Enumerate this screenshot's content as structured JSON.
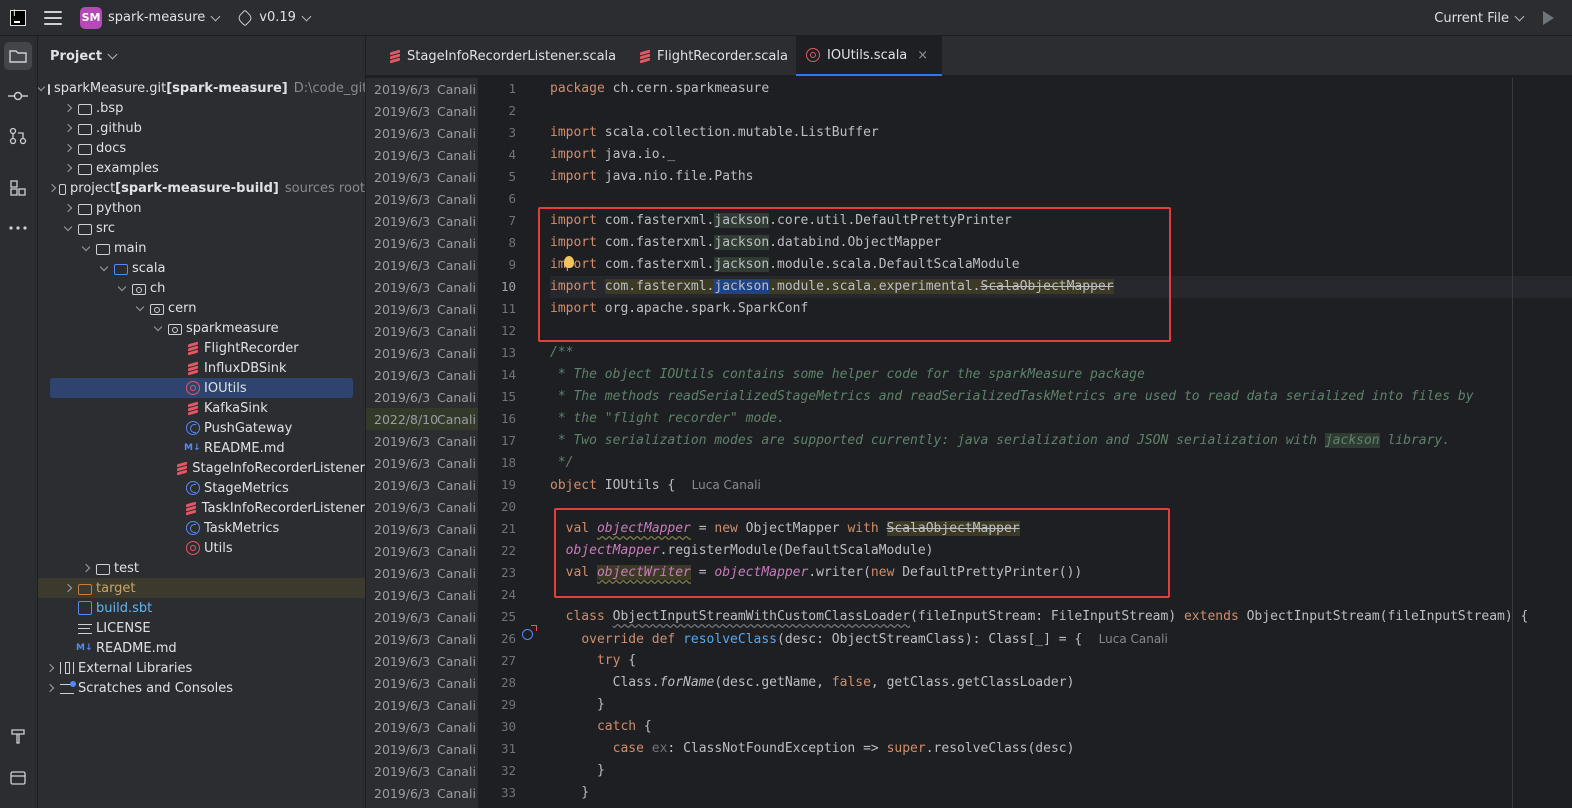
{
  "topbar": {
    "project_badge": "SM",
    "project_name": "spark-measure",
    "branch": "v0.19",
    "run_config": "Current File"
  },
  "project_panel": {
    "title": "Project",
    "tree": [
      {
        "label": "sparkMeasure.git",
        "bold_suffix": "[spark-measure]",
        "dim": "D:\\code_gith",
        "depth": 0,
        "expanded": true,
        "icon": "folder-icon"
      },
      {
        "label": ".bsp",
        "depth": 1,
        "expanded": false,
        "icon": "folder-icon"
      },
      {
        "label": ".github",
        "depth": 1,
        "expanded": false,
        "icon": "folder-icon"
      },
      {
        "label": "docs",
        "depth": 1,
        "expanded": false,
        "icon": "folder-icon"
      },
      {
        "label": "examples",
        "depth": 1,
        "expanded": false,
        "icon": "folder-icon"
      },
      {
        "label": "project",
        "bold_suffix": "[spark-measure-build]",
        "dim": "sources root",
        "depth": 1,
        "expanded": false,
        "icon": "folder-icon"
      },
      {
        "label": "python",
        "depth": 1,
        "expanded": false,
        "icon": "folder-icon"
      },
      {
        "label": "src",
        "depth": 1,
        "expanded": true,
        "icon": "folder-icon"
      },
      {
        "label": "main",
        "depth": 2,
        "expanded": true,
        "icon": "folder-icon"
      },
      {
        "label": "scala",
        "depth": 3,
        "expanded": true,
        "icon": "source-folder-icon"
      },
      {
        "label": "ch",
        "depth": 4,
        "expanded": true,
        "icon": "package-icon"
      },
      {
        "label": "cern",
        "depth": 5,
        "expanded": true,
        "icon": "package-icon"
      },
      {
        "label": "sparkmeasure",
        "depth": 6,
        "expanded": true,
        "icon": "package-icon"
      },
      {
        "label": "FlightRecorder",
        "depth": 7,
        "icon": "scala-file-icon"
      },
      {
        "label": "InfluxDBSink",
        "depth": 7,
        "icon": "scala-file-icon"
      },
      {
        "label": "IOUtils",
        "depth": 7,
        "icon": "scala-object-icon",
        "selected": true
      },
      {
        "label": "KafkaSink",
        "depth": 7,
        "icon": "scala-file-icon"
      },
      {
        "label": "PushGateway",
        "depth": 7,
        "icon": "scala-class-icon"
      },
      {
        "label": "README.md",
        "depth": 7,
        "icon": "markdown-icon"
      },
      {
        "label": "StageInfoRecorderListener",
        "depth": 7,
        "icon": "scala-file-icon"
      },
      {
        "label": "StageMetrics",
        "depth": 7,
        "icon": "scala-class-icon"
      },
      {
        "label": "TaskInfoRecorderListener",
        "depth": 7,
        "icon": "scala-file-icon"
      },
      {
        "label": "TaskMetrics",
        "depth": 7,
        "icon": "scala-class-icon"
      },
      {
        "label": "Utils",
        "depth": 7,
        "icon": "scala-object-icon"
      },
      {
        "label": "test",
        "depth": 2,
        "expanded": false,
        "icon": "folder-icon"
      },
      {
        "label": "target",
        "depth": 1,
        "expanded": false,
        "icon": "excluded-folder-icon",
        "highlight": true
      },
      {
        "label": "build.sbt",
        "depth": 1,
        "icon": "sbt-file-icon",
        "blue": true
      },
      {
        "label": "LICENSE",
        "depth": 1,
        "icon": "text-file-icon"
      },
      {
        "label": "README.md",
        "depth": 1,
        "icon": "markdown-icon"
      },
      {
        "label": "External Libraries",
        "depth": 0,
        "expanded": false,
        "icon": "library-icon"
      },
      {
        "label": "Scratches and Consoles",
        "depth": 0,
        "expanded": false,
        "icon": "scratches-icon"
      }
    ]
  },
  "tabs": [
    {
      "label": "StageInfoRecorderListener.scala",
      "icon": "scala-file-icon"
    },
    {
      "label": "FlightRecorder.scala",
      "icon": "scala-file-icon"
    },
    {
      "label": "IOUtils.scala",
      "icon": "scala-object-icon",
      "active": true
    }
  ],
  "close_glyph": "×",
  "blame": {
    "author": "Canali",
    "dates": [
      "2019/6/3",
      "2019/6/3",
      "2019/6/3",
      "2019/6/3",
      "2019/6/3",
      "2019/6/3",
      "2019/6/3",
      "2019/6/3",
      "2019/6/3",
      "2019/6/3",
      "2019/6/3",
      "2019/6/3",
      "2019/6/3",
      "2019/6/3",
      "2019/6/3",
      "2022/8/10",
      "2019/6/3",
      "2019/6/3",
      "2019/6/3",
      "2019/6/3",
      "2019/6/3",
      "2019/6/3",
      "2019/6/3",
      "2019/6/3",
      "2019/6/3",
      "2019/6/3",
      "2019/6/3",
      "2019/6/3",
      "2019/6/3",
      "2019/6/3",
      "2019/6/3",
      "2019/6/3",
      "2019/6/3"
    ]
  },
  "current_line": 10,
  "inlay_author": "Luca Canali",
  "code_lines": [
    "package ch.cern.sparkmeasure",
    "",
    "import scala.collection.mutable.ListBuffer",
    "import java.io._",
    "import java.nio.file.Paths",
    "",
    "import com.fasterxml.jackson.core.util.DefaultPrettyPrinter",
    "import com.fasterxml.jackson.databind.ObjectMapper",
    "import com.fasterxml.jackson.module.scala.DefaultScalaModule",
    "import com.fasterxml.jackson.module.scala.experimental.ScalaObjectMapper",
    "import org.apache.spark.SparkConf",
    "",
    "/**",
    " * The object IOUtils contains some helper code for the sparkMeasure package",
    " * The methods readSerializedStageMetrics and readSerializedTaskMetrics are used to read data serialized into files by",
    " * the \"flight recorder\" mode.",
    " * Two serialization modes are supported currently: java serialization and JSON serialization with jackson library.",
    " */",
    "object IOUtils {",
    "",
    "  val objectMapper = new ObjectMapper with ScalaObjectMapper",
    "  objectMapper.registerModule(DefaultScalaModule)",
    "  val objectWriter = objectMapper.writer(new DefaultPrettyPrinter())",
    "",
    "  class ObjectInputStreamWithCustomClassLoader(fileInputStream: FileInputStream) extends ObjectInputStream(fileInputStream) {",
    "    override def resolveClass(desc: ObjectStreamClass): Class[_] = {",
    "      try {",
    "        Class.forName(desc.getName, false, getClass.getClassLoader)",
    "      }",
    "      catch {",
    "        case ex: ClassNotFoundException => super.resolveClass(desc)",
    "      }",
    "    }"
  ],
  "colors": {
    "keyword": "#cf8e6d",
    "comment": "#5f826b",
    "field": "#c77dbb",
    "highlight_box": "#e53d3d",
    "accent": "#3574f0"
  }
}
